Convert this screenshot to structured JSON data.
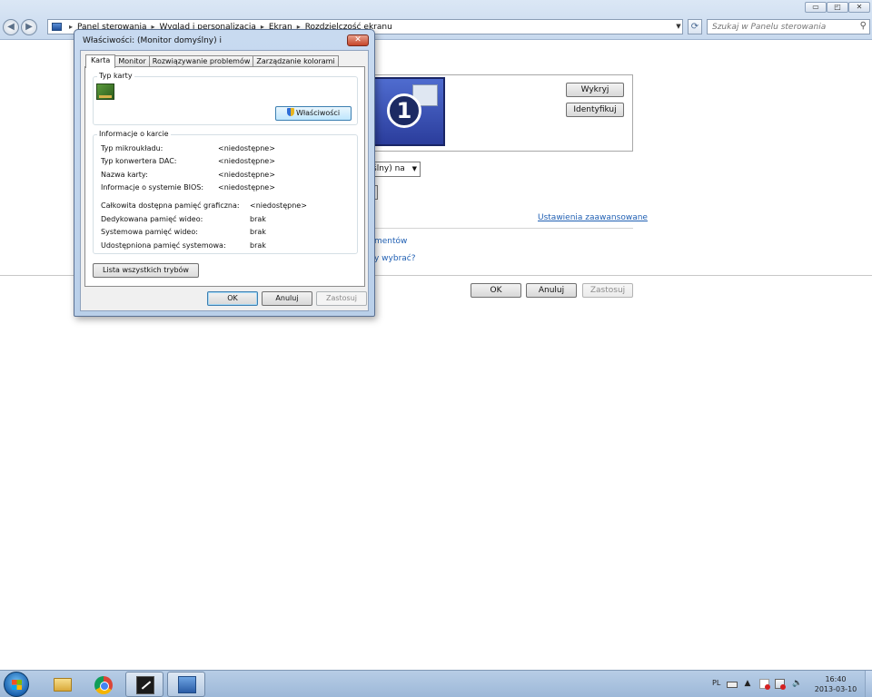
{
  "window": {
    "minimize_glyph": "▭",
    "maximize_glyph": "◰",
    "close_glyph": "✕"
  },
  "address_bar": {
    "breadcrumbs": [
      "Panel sterowania",
      "Wygląd i personalizacja",
      "Ekran",
      "Rozdzielczość ekranu"
    ]
  },
  "search": {
    "placeholder": "Szukaj w Panelu sterowania"
  },
  "background_page": {
    "detect_label": "Wykryj",
    "identify_label": "Identyfikuj",
    "monitor_number": "1",
    "display_select_value": "ślny) na",
    "advanced_link": "Ustawienia zaawansowane",
    "link_text_elements": "mentów",
    "link_text_choose": "y wybrać?",
    "ok_label": "OK",
    "cancel_label": "Anuluj",
    "apply_label": "Zastosuj"
  },
  "dialog": {
    "title": "Właściwości: (Monitor domyślny) i",
    "close_glyph": "✕",
    "tabs": [
      {
        "label": "Karta",
        "active": true
      },
      {
        "label": "Monitor",
        "active": false
      },
      {
        "label": "Rozwiązywanie problemów",
        "active": false
      },
      {
        "label": "Zarządzanie kolorami",
        "active": false
      }
    ],
    "adapter_type_label": "Typ karty",
    "properties_button": "Właściwości",
    "adapter_info_label": "Informacje o karcie",
    "info_rows": [
      {
        "label": "Typ mikroukładu:",
        "value": "<niedostępne>"
      },
      {
        "label": "Typ konwertera DAC:",
        "value": "<niedostępne>"
      },
      {
        "label": "Nazwa karty:",
        "value": "<niedostępne>"
      },
      {
        "label": "Informacje o systemie BIOS:",
        "value": "<niedostępne>"
      }
    ],
    "memory_rows": [
      {
        "label": "Całkowita dostępna pamięć graficzna:",
        "value": "<niedostępne>"
      },
      {
        "label": "Dedykowana pamięć wideo:",
        "value": "brak"
      },
      {
        "label": "Systemowa pamięć wideo:",
        "value": "brak"
      },
      {
        "label": "Udostępniona pamięć systemowa:",
        "value": "brak"
      }
    ],
    "list_modes_button": "Lista wszystkich trybów",
    "ok_label": "OK",
    "cancel_label": "Anuluj",
    "apply_label": "Zastosuj"
  },
  "taskbar": {
    "language": "PL",
    "time": "16:40",
    "date": "2013-03-10",
    "items": [
      "explorer-folder-icon",
      "chrome-icon",
      "tool-icon",
      "control-panel-icon"
    ]
  }
}
